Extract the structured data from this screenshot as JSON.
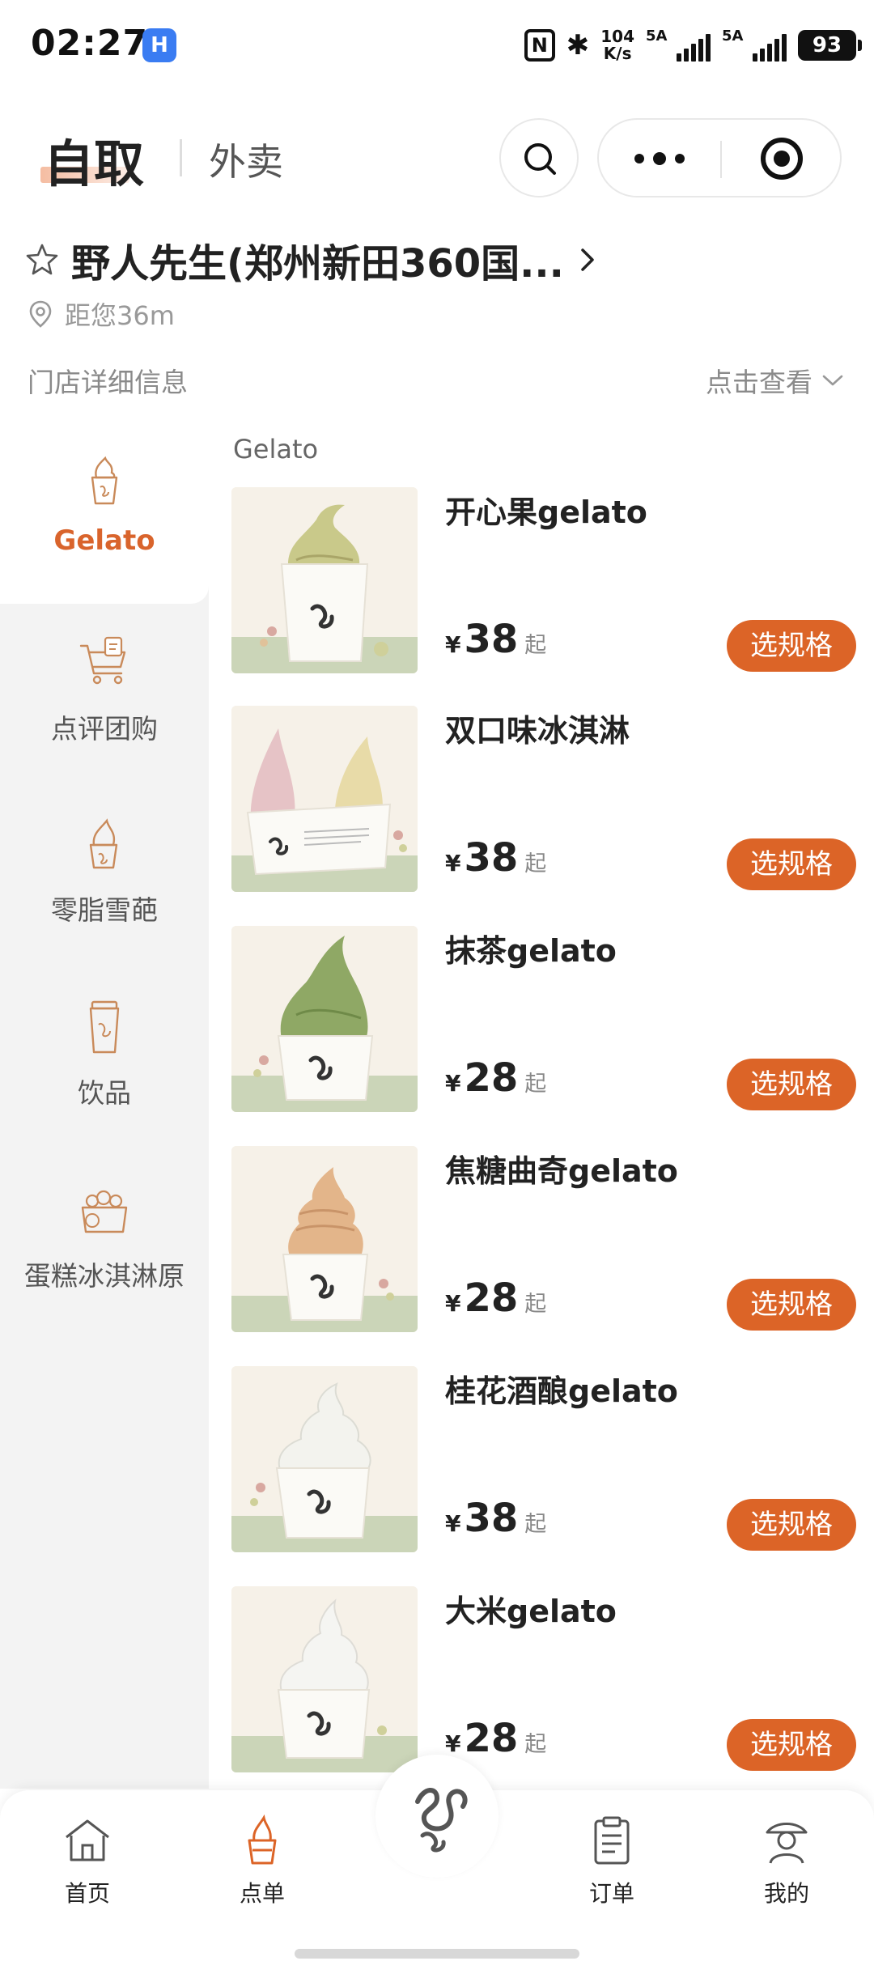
{
  "status_bar": {
    "time": "02:27",
    "app_badge": "H",
    "nfc": "N",
    "net_speed_value": "104",
    "net_speed_unit": "K/s",
    "sim1": "5A",
    "sim2": "5A",
    "battery": "93"
  },
  "header": {
    "mode_active": "自取",
    "mode_inactive": "外卖"
  },
  "store": {
    "name": "野人先生(郑州新田360国...",
    "distance": "距您36m",
    "detail_label": "门店详细信息",
    "detail_action": "点击查看"
  },
  "sidebar": {
    "items": [
      {
        "label": "Gelato",
        "icon": "ice-cream-cup-icon",
        "active": true
      },
      {
        "label": "点评团购",
        "icon": "shopping-cart-icon",
        "active": false
      },
      {
        "label": "零脂雪葩",
        "icon": "sorbet-icon",
        "active": false
      },
      {
        "label": "饮品",
        "icon": "drink-cup-icon",
        "active": false
      },
      {
        "label": "蛋糕冰淇淋原",
        "icon": "cake-icon",
        "active": false
      }
    ]
  },
  "menu": {
    "section_title": "Gelato",
    "currency": "¥",
    "from_suffix": "起",
    "button_label": "选规格",
    "products": [
      {
        "name": "开心果gelato",
        "price": "38"
      },
      {
        "name": "双口味冰淇淋",
        "price": "38"
      },
      {
        "name": "抹茶gelato",
        "price": "28"
      },
      {
        "name": "焦糖曲奇gelato",
        "price": "28"
      },
      {
        "name": "桂花酒酿gelato",
        "price": "38"
      },
      {
        "name": "大米gelato",
        "price": "28"
      }
    ]
  },
  "tabbar": {
    "items": [
      {
        "label": "首页",
        "icon": "home-icon"
      },
      {
        "label": "点单",
        "icon": "order-ice-cream-icon",
        "active": true
      },
      {
        "label": "订单",
        "icon": "clipboard-icon"
      },
      {
        "label": "我的",
        "icon": "profile-icon"
      }
    ],
    "logo": "brand-logo-icon"
  },
  "colors": {
    "accent": "#dc6427",
    "sidebar_bg": "#f3f3f3"
  }
}
